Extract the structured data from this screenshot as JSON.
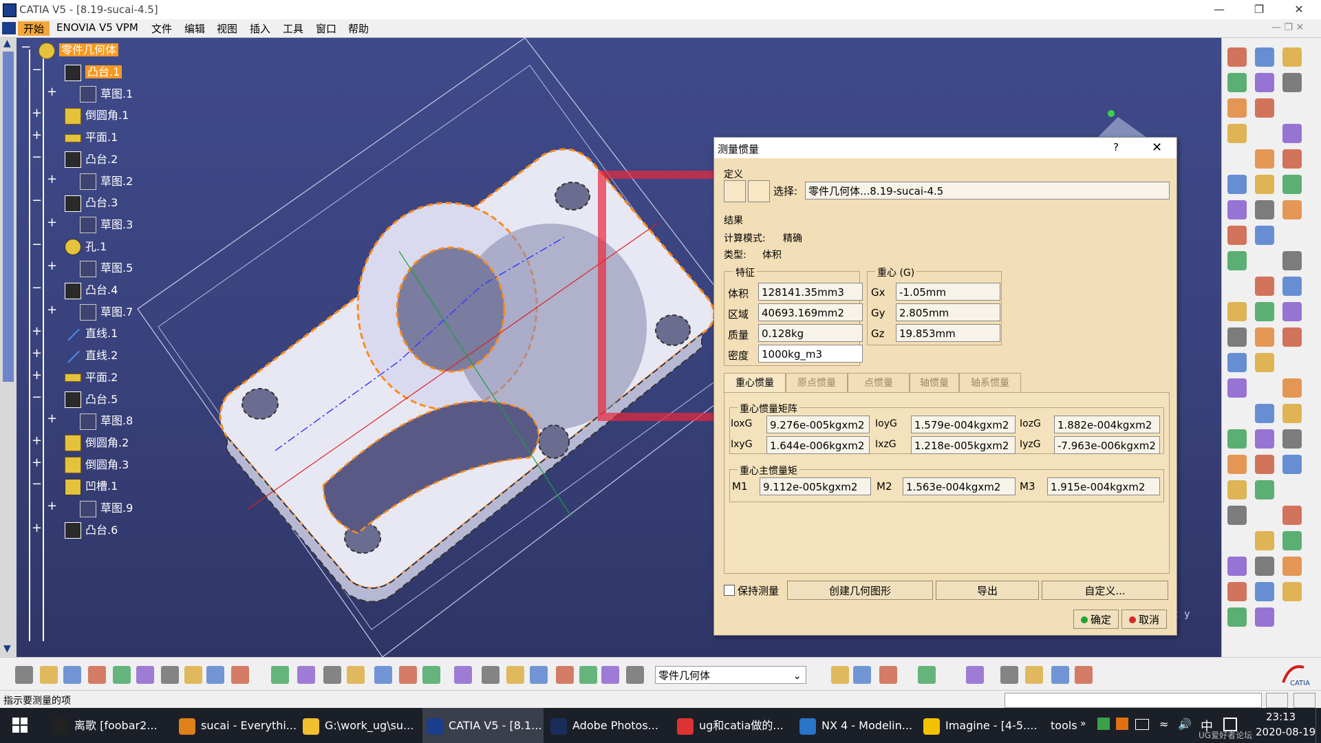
{
  "window": {
    "title": "CATIA V5 - [8.19-sucai-4.5]"
  },
  "menu": [
    "开始",
    "ENOVIA V5 VPM",
    "文件",
    "编辑",
    "视图",
    "插入",
    "工具",
    "窗口",
    "帮助"
  ],
  "tree": {
    "root": "零件几何体",
    "items": [
      {
        "label": "凸台.1",
        "indent": 1,
        "icon": "pad-icon",
        "selected": true
      },
      {
        "label": "草图.1",
        "indent": 2,
        "icon": "sketch-icon"
      },
      {
        "label": "倒圆角.1",
        "indent": 1,
        "icon": "fillet-icon"
      },
      {
        "label": "平面.1",
        "indent": 1,
        "icon": "plane-icon"
      },
      {
        "label": "凸台.2",
        "indent": 1,
        "icon": "pad-icon"
      },
      {
        "label": "草图.2",
        "indent": 2,
        "icon": "sketch-icon"
      },
      {
        "label": "凸台.3",
        "indent": 1,
        "icon": "pad-icon"
      },
      {
        "label": "草图.3",
        "indent": 2,
        "icon": "sketch-icon"
      },
      {
        "label": "孔.1",
        "indent": 1,
        "icon": "hole-icon"
      },
      {
        "label": "草图.5",
        "indent": 2,
        "icon": "sketch-icon"
      },
      {
        "label": "凸台.4",
        "indent": 1,
        "icon": "pad-icon"
      },
      {
        "label": "草图.7",
        "indent": 2,
        "icon": "sketch-icon"
      },
      {
        "label": "直线.1",
        "indent": 1,
        "icon": "line-icon"
      },
      {
        "label": "直线.2",
        "indent": 1,
        "icon": "line-icon"
      },
      {
        "label": "平面.2",
        "indent": 1,
        "icon": "plane-icon"
      },
      {
        "label": "凸台.5",
        "indent": 1,
        "icon": "pad-icon"
      },
      {
        "label": "草图.8",
        "indent": 2,
        "icon": "sketch-icon"
      },
      {
        "label": "倒圆角.2",
        "indent": 1,
        "icon": "fillet-icon"
      },
      {
        "label": "倒圆角.3",
        "indent": 1,
        "icon": "fillet-icon"
      },
      {
        "label": "凹槽.1",
        "indent": 1,
        "icon": "pocket-icon"
      },
      {
        "label": "草图.9",
        "indent": 2,
        "icon": "sketch-icon"
      },
      {
        "label": "凸台.6",
        "indent": 1,
        "icon": "pad-icon"
      }
    ]
  },
  "dialog": {
    "title": "测量惯量",
    "help": "?",
    "definition_label": "定义",
    "select_label": "选择:",
    "select_value": "零件几何体...8.19-sucai-4.5",
    "result_label": "结果",
    "calc_mode_label": "计算模式:",
    "calc_mode_value": "精确",
    "type_label": "类型:",
    "type_value": "体积",
    "features_label": "特征",
    "cog_label": "重心 (G)",
    "volume_label": "体积",
    "volume_value": "128141.35mm3",
    "area_label": "区域",
    "area_value": "40693.169mm2",
    "mass_label": "质量",
    "mass_value": "0.128kg",
    "density_label": "密度",
    "density_value": "1000kg_m3",
    "gx_label": "Gx",
    "gx_value": "-1.05mm",
    "gy_label": "Gy",
    "gy_value": "2.805mm",
    "gz_label": "Gz",
    "gz_value": "19.853mm",
    "tabs": [
      "重心惯量",
      "原点惯量",
      "点惯量",
      "轴惯量",
      "轴系惯量"
    ],
    "matrix_label": "重心惯量矩阵",
    "ioxg_label": "IoxG",
    "ioxg_value": "9.276e-005kgxm2",
    "ioyg_label": "IoyG",
    "ioyg_value": "1.579e-004kgxm2",
    "iozg_label": "IozG",
    "iozg_value": "1.882e-004kgxm2",
    "ixyg_label": "IxyG",
    "ixyg_value": "1.644e-006kgxm2",
    "ixzg_label": "IxzG",
    "ixzg_value": "1.218e-005kgxm2",
    "iyzg_label": "IyzG",
    "iyzg_value": "-7.963e-006kgxm2",
    "principal_label": "重心主惯量矩",
    "m1_label": "M1",
    "m1_value": "9.112e-005kgxm2",
    "m2_label": "M2",
    "m2_value": "1.563e-004kgxm2",
    "m3_label": "M3",
    "m3_value": "1.915e-004kgxm2",
    "keep_label": "保持测量",
    "create_geom": "创建几何图形",
    "export": "导出",
    "customize": "自定义...",
    "ok": "确定",
    "cancel": "取消"
  },
  "bottombar": {
    "dropdown_value": "零件几何体"
  },
  "status": {
    "text": "指示要测量的项"
  },
  "taskbar": {
    "tasks": [
      {
        "label": "离歌 [foobar2...",
        "color": "#222"
      },
      {
        "label": "sucai - Everythi...",
        "color": "#e0801a"
      },
      {
        "label": "G:\\work_ug\\su...",
        "color": "#f0c030"
      },
      {
        "label": "CATIA V5 - [8.1...",
        "color": "#1a3d8c"
      },
      {
        "label": "Adobe Photos...",
        "color": "#1a2d5a"
      },
      {
        "label": "ug和catia做的...",
        "color": "#d33"
      },
      {
        "label": "NX 4 - Modelin...",
        "color": "#2a74c9"
      },
      {
        "label": "Imagine - [4-5....",
        "color": "#f2c200"
      }
    ],
    "tools": "tools",
    "time": "23:13",
    "date": "2020-08-19",
    "ime": "中",
    "watermark": "UG爱好者论坛"
  }
}
